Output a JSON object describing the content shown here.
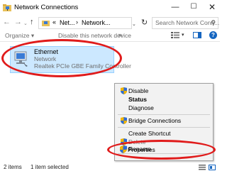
{
  "window": {
    "title": "Network Connections",
    "minimize_glyph": "—",
    "maximize_glyph": "☐",
    "close_glyph": "✕"
  },
  "nav": {
    "back_glyph": "←",
    "forward_glyph": "→",
    "recent_glyph": "⌄",
    "up_glyph": "↑"
  },
  "address": {
    "separator": "«",
    "crumb1": "Net...",
    "crumb_arrow": "›",
    "crumb2": "Network...",
    "dropdown_glyph": "⌄",
    "refresh_glyph": "↻"
  },
  "search": {
    "placeholder": "Search Network Conn...",
    "icon_glyph": "⚲"
  },
  "command_bar": {
    "organize": "Organize ▾",
    "disable": "Disable this network device",
    "more": "»",
    "view_dropdown": "▾",
    "help": "?"
  },
  "item": {
    "name": "Ethernet",
    "network": "Network",
    "adapter": "Realtek PCIe GBE Family Controller"
  },
  "context_menu": {
    "items": [
      {
        "label": "Disable",
        "shield": true,
        "style": "normal"
      },
      {
        "label": "Status",
        "shield": false,
        "style": "bold"
      },
      {
        "label": "Diagnose",
        "shield": false,
        "style": "normal"
      },
      {
        "label": "Bridge Connections",
        "shield": true,
        "style": "normal"
      },
      {
        "label": "Create Shortcut",
        "shield": false,
        "style": "normal"
      },
      {
        "label": "Delete",
        "shield": true,
        "style": "dim"
      },
      {
        "label": "Rename",
        "shield": true,
        "style": "normal"
      },
      {
        "label": "Properties",
        "shield": true,
        "style": "normal"
      }
    ]
  },
  "status_bar": {
    "count": "2 items",
    "selected": "1 item selected"
  },
  "colors": {
    "selection_fill": "#cce8ff",
    "selection_border": "#99d1ff",
    "annotation_red": "#e01b1b",
    "help_blue": "#1565c0"
  },
  "icons": [
    "network-folder-icon",
    "shield-icon",
    "ethernet-adapter-icon",
    "view-options-icon",
    "preview-pane-icon",
    "help-icon"
  ]
}
